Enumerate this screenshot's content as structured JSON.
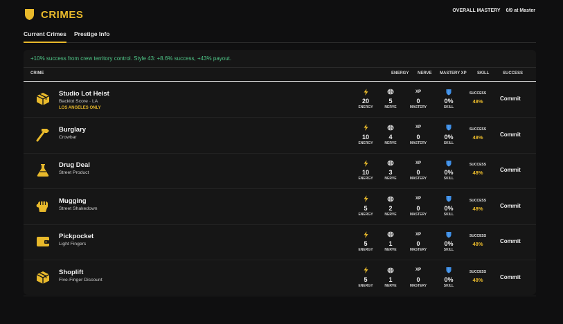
{
  "header": {
    "title": "CRIMES",
    "mastery_label": "OVERALL MASTERY",
    "mastery_value": "0/9 at Master"
  },
  "tabs": [
    {
      "label": "Current Crimes"
    },
    {
      "label": "Prestige Info"
    }
  ],
  "banner": "+10% success from crew territory control. Style 43: +8.6% success, +43% payout.",
  "columns": {
    "crime": "CRIME",
    "energy": "ENERGY",
    "nerve": "NERVE",
    "mastery_xp": "MASTERY XP",
    "skill": "SKILL",
    "success": "SUCCESS"
  },
  "stat_captions": {
    "energy": "ENERGY",
    "nerve": "NERVE",
    "mastery": "MASTERY",
    "skill": "SKILL",
    "xp": "XP",
    "success": "SUCCESS"
  },
  "commit_label": "Commit",
  "crimes": [
    {
      "name": "Studio Lot Heist",
      "sub": "Backlot Score · LA",
      "note": "LOS ANGELES ONLY",
      "icon": "box-icon",
      "energy": "20",
      "nerve": "5",
      "mastery": "0",
      "skill": "0%",
      "success": "48%"
    },
    {
      "name": "Burglary",
      "sub": "Crowbar",
      "icon": "hammer-icon",
      "energy": "10",
      "nerve": "4",
      "mastery": "0",
      "skill": "0%",
      "success": "48%"
    },
    {
      "name": "Drug Deal",
      "sub": "Street Product",
      "icon": "flask-icon",
      "energy": "10",
      "nerve": "3",
      "mastery": "0",
      "skill": "0%",
      "success": "48%"
    },
    {
      "name": "Mugging",
      "sub": "Street Shakedown",
      "icon": "fist-icon",
      "energy": "5",
      "nerve": "2",
      "mastery": "0",
      "skill": "0%",
      "success": "48%"
    },
    {
      "name": "Pickpocket",
      "sub": "Light Fingers",
      "icon": "wallet-icon",
      "energy": "5",
      "nerve": "1",
      "mastery": "0",
      "skill": "0%",
      "success": "48%"
    },
    {
      "name": "Shoplift",
      "sub": "Five-Finger Discount",
      "icon": "box-icon",
      "energy": "5",
      "nerve": "1",
      "mastery": "0",
      "skill": "0%",
      "success": "48%"
    }
  ],
  "colors": {
    "accent": "#e8b92b",
    "banner": "#4fc587",
    "skill_shield": "#3d8ee6"
  }
}
